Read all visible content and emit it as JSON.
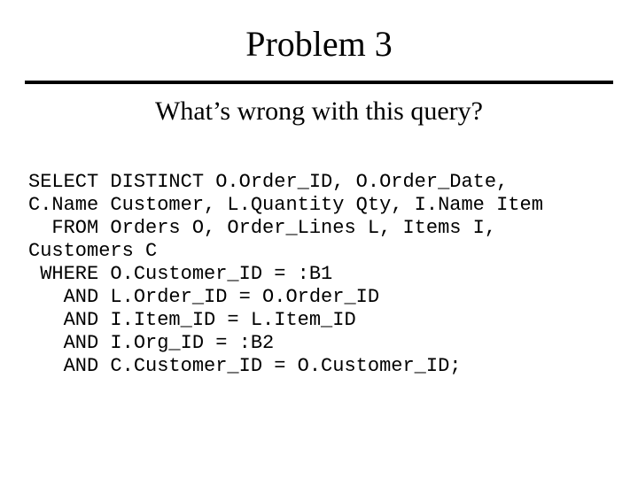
{
  "title": "Problem 3",
  "subtitle": "What’s wrong with this query?",
  "code_lines": [
    "SELECT DISTINCT O.Order_ID, O.Order_Date,",
    "C.Name Customer, L.Quantity Qty, I.Name Item",
    "  FROM Orders O, Order_Lines L, Items I,",
    "Customers C",
    " WHERE O.Customer_ID = :B1",
    "   AND L.Order_ID = O.Order_ID",
    "   AND I.Item_ID = L.Item_ID",
    "   AND I.Org_ID = :B2",
    "   AND C.Customer_ID = O.Customer_ID;"
  ]
}
